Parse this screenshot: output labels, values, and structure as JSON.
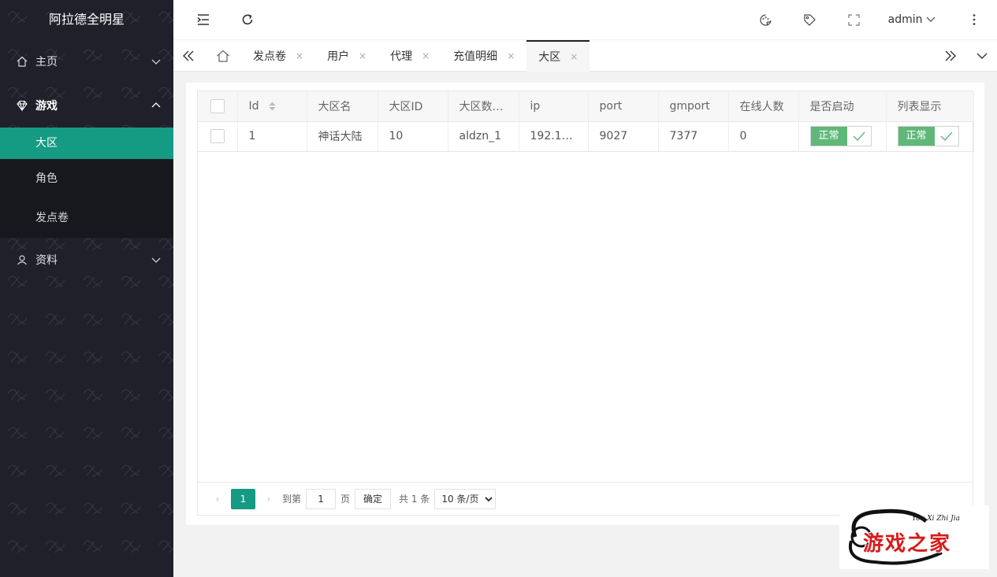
{
  "app": {
    "title": "阿拉德全明星"
  },
  "sidebar": {
    "menu": [
      {
        "label": "主页",
        "icon": "home-icon"
      },
      {
        "label": "游戏",
        "icon": "diamond-icon",
        "expanded": true,
        "children": [
          {
            "label": "大区",
            "active": true
          },
          {
            "label": "角色"
          },
          {
            "label": "发点卷"
          }
        ]
      },
      {
        "label": "资料",
        "icon": "user-icon"
      }
    ]
  },
  "header": {
    "user": "admin"
  },
  "tabs": {
    "items": [
      {
        "label": "发点卷",
        "close": "×"
      },
      {
        "label": "用户",
        "close": "×"
      },
      {
        "label": "代理",
        "close": "×"
      },
      {
        "label": "充值明细",
        "close": "×"
      },
      {
        "label": "大区",
        "close": "×",
        "active": true
      }
    ]
  },
  "table": {
    "columns": [
      "Id",
      "大区名",
      "大区ID",
      "大区数…",
      "ip",
      "port",
      "gmport",
      "在线人数",
      "是否启动",
      "列表显示"
    ],
    "rows": [
      {
        "id": "1",
        "name": "神话大陆",
        "zone_id": "10",
        "db": "aldzn_1",
        "ip": "192.16…",
        "port": "9027",
        "gmport": "7377",
        "online": "0",
        "enabled": "正常",
        "listed": "正常"
      }
    ]
  },
  "pager": {
    "current": "1",
    "goto_label": "到第",
    "goto_value": "1",
    "page_unit": "页",
    "confirm": "确定",
    "total": "共 1 条",
    "page_size": "10 条/页"
  },
  "logo": {
    "text": "游戏之家",
    "sub": "You Xi Zhi Jia"
  },
  "colors": {
    "accent": "#159a83",
    "sidebar": "#1f2029",
    "switch_on": "#5fb878"
  }
}
